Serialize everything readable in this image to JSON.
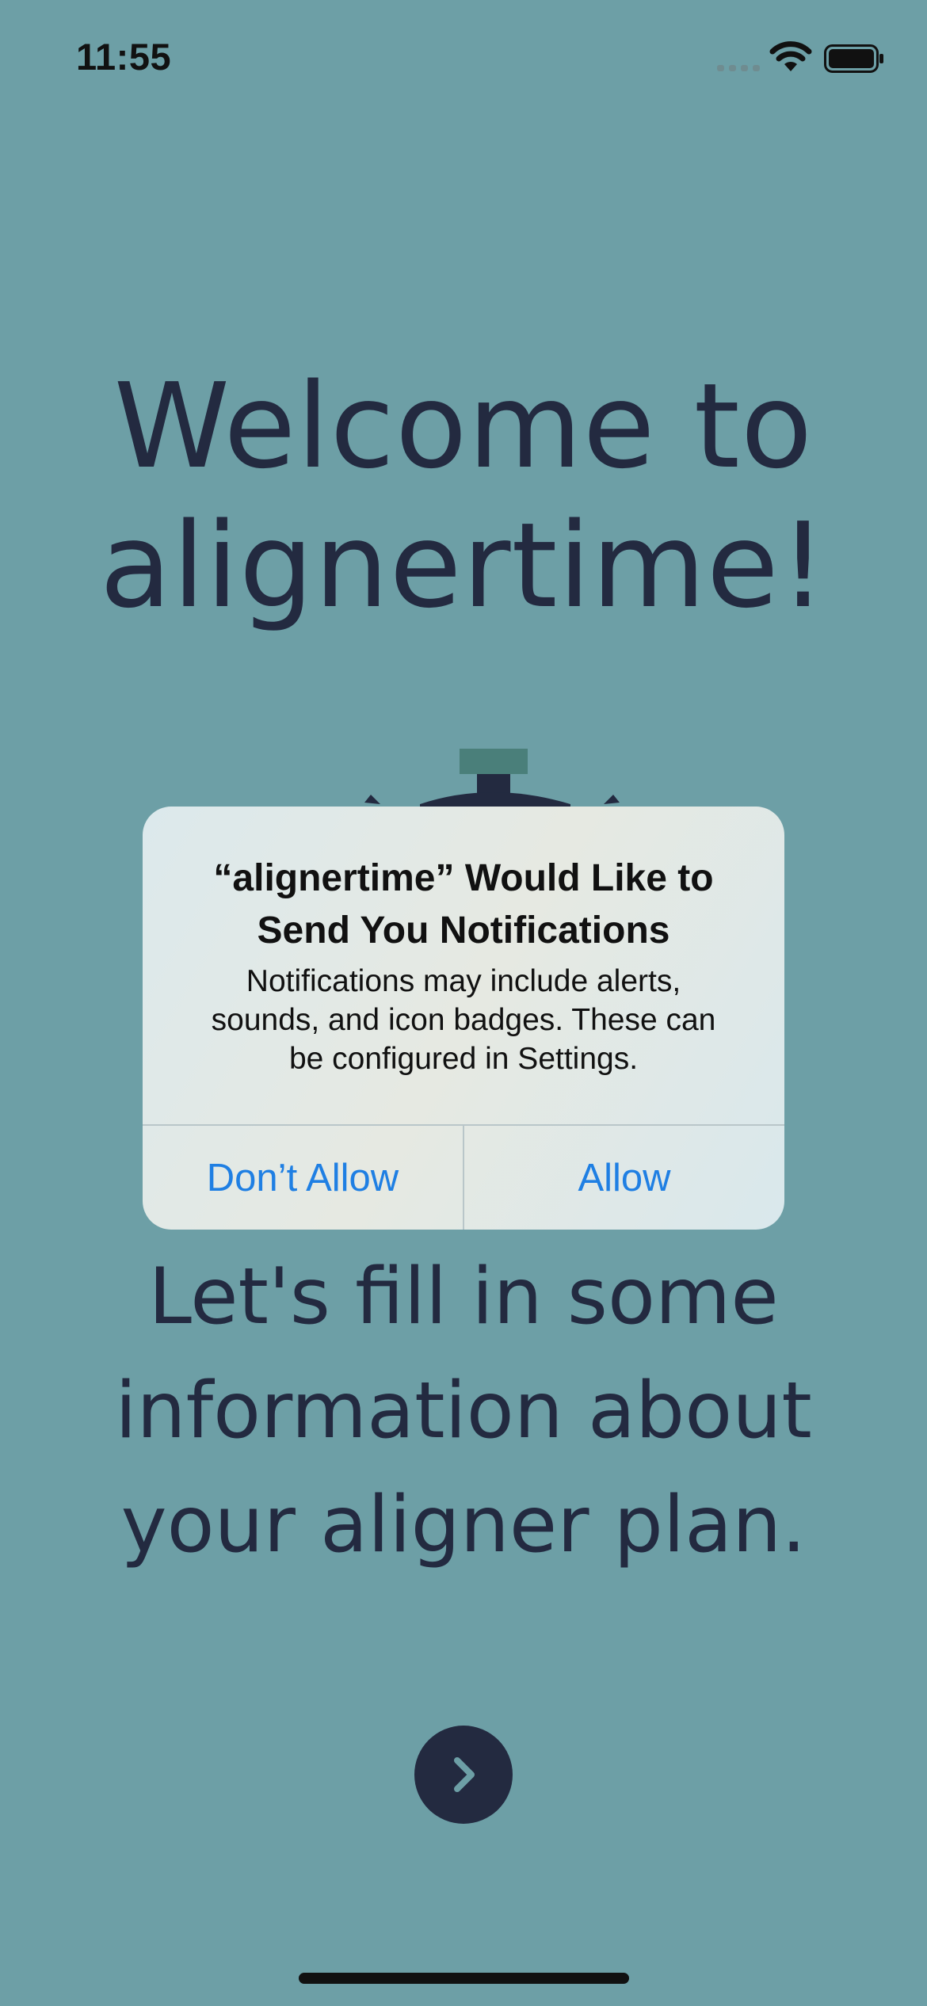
{
  "status_bar": {
    "time": "11:55",
    "icons": [
      "cellular-signal-icon",
      "wifi-icon",
      "battery-icon"
    ]
  },
  "welcome": {
    "line1": "Welcome to",
    "line2": "alignertime!"
  },
  "info": {
    "line1": "Let's fill in some",
    "line2": "information about",
    "line3": "your aligner plan."
  },
  "next_button": {
    "icon": "chevron-right-icon"
  },
  "alert": {
    "title_line1": "“alignertime” Would Like to",
    "title_line2": "Send You Notifications",
    "message_line1": "Notifications may include alerts,",
    "message_line2": "sounds, and icon badges. These can",
    "message_line3": "be configured in Settings.",
    "dont_allow_label": "Don’t Allow",
    "allow_label": "Allow"
  },
  "colors": {
    "background": "#6d9fa6",
    "text_dark": "#232a40",
    "accent_blue": "#1f7fe3",
    "stopwatch_cap": "#4a7f7a"
  }
}
